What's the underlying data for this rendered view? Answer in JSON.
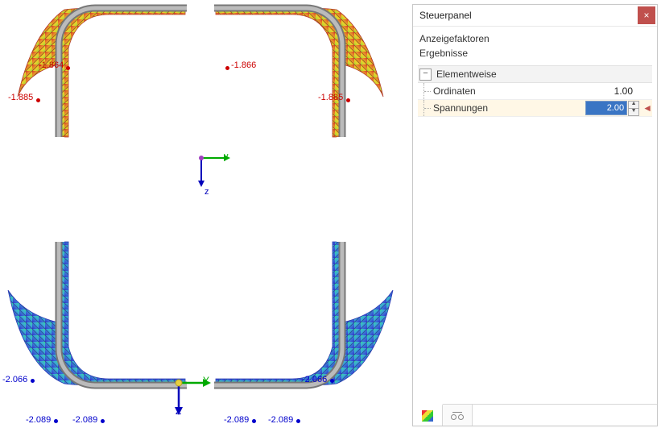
{
  "panel": {
    "title": "Steuerpanel",
    "section1": "Anzeigefaktoren",
    "section2": "Ergebnisse",
    "group": "Elementweise",
    "group_toggle": "−",
    "rows": {
      "ordinaten": {
        "label": "Ordinaten",
        "value": "1.00"
      },
      "spannungen": {
        "label": "Spannungen",
        "value": "2.00"
      }
    },
    "close_glyph": "×",
    "marker_glyph": "◄"
  },
  "axes": {
    "Y": "Y",
    "Z": "Z",
    "y": "y",
    "z": "z"
  },
  "values": {
    "top_left_a": "-1.864",
    "top_left_b": "-1.885",
    "top_right_a": "-1.866",
    "top_right_b": "-1.885",
    "bot_left_a": "-2.066",
    "bot_left_b": "-2.089",
    "bot_left_c": "-2.089",
    "bot_right_a": "-2.066",
    "bot_right_b": "-2.089",
    "bot_right_c": "-2.089"
  }
}
